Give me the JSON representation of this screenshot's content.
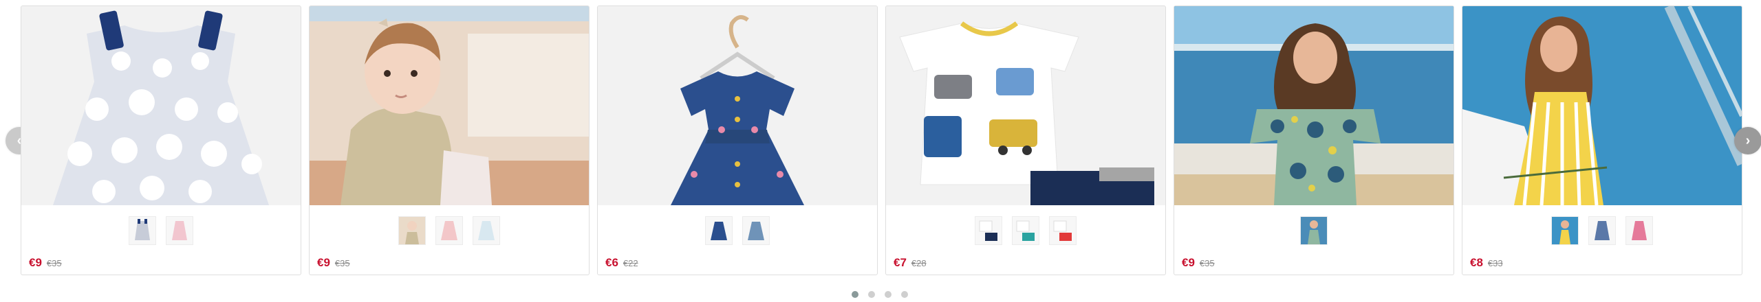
{
  "carousel": {
    "prev_icon": "chevron-left-icon",
    "next_icon": "chevron-right-icon",
    "prev_glyph": "‹",
    "next_glyph": "›",
    "active_page": 1,
    "page_count": 4,
    "products": [
      {
        "image": "dress-grey-polka-dot",
        "thumbnails": [
          "dress-grey-dots-swatch",
          "dress-pink-swatch"
        ],
        "price": "€9",
        "old_price": "€35"
      },
      {
        "image": "baby-in-beige-cardigan",
        "thumbnails": [
          "baby-outfit-swatch",
          "dress-pink-swatch",
          "dress-light-blue-swatch"
        ],
        "price": "€9",
        "old_price": "€35"
      },
      {
        "image": "denim-dress-on-hanger",
        "thumbnails": [
          "denim-dress-dark-swatch",
          "denim-dress-light-swatch"
        ],
        "price": "€6",
        "old_price": "€22"
      },
      {
        "image": "tshirt-and-shorts-cars",
        "thumbnails": [
          "tshirt-navy-shorts-swatch",
          "tshirt-teal-swatch",
          "tshirt-red-swatch"
        ],
        "price": "€7",
        "old_price": "€28"
      },
      {
        "image": "girl-green-print-dress-beach",
        "thumbnails": [
          "green-dress-swatch"
        ],
        "price": "€9",
        "old_price": "€35"
      },
      {
        "image": "girl-yellow-stripe-dress-boat",
        "thumbnails": [
          "yellow-dress-swatch",
          "blue-dress-swatch",
          "pink-dress-swatch"
        ],
        "price": "€8",
        "old_price": "€33"
      }
    ]
  },
  "colors": {
    "price": "#c8102e",
    "old_price": "#8c8c8c",
    "card_border": "#dedede",
    "dot_active": "#8a9a9a",
    "dot_inactive": "#cfcfcf"
  }
}
